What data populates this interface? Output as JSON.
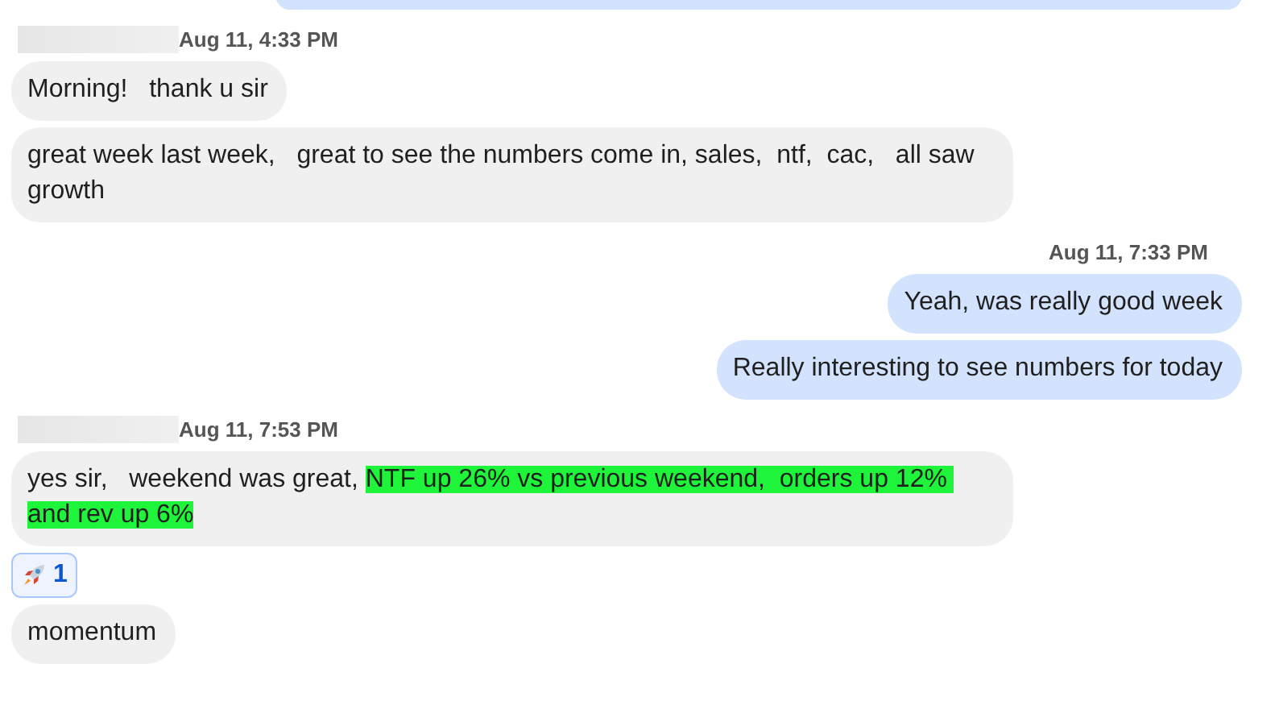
{
  "groups": [
    {
      "kind": "clipped"
    },
    {
      "kind": "incoming",
      "name_redacted": true,
      "time": "Aug 11, 4:33 PM",
      "messages": [
        {
          "segments": [
            {
              "text": "Morning!   thank u sir",
              "highlight": false
            }
          ]
        },
        {
          "segments": [
            {
              "text": "great week last week,   great to see the numbers come in, sales,  ntf,  cac,   all saw growth",
              "highlight": false
            }
          ]
        }
      ]
    },
    {
      "kind": "outgoing",
      "name_redacted": false,
      "time": "Aug 11, 7:33 PM",
      "messages": [
        {
          "segments": [
            {
              "text": "Yeah, was really good week",
              "highlight": false
            }
          ]
        },
        {
          "segments": [
            {
              "text": "Really interesting to see numbers for today",
              "highlight": false
            }
          ]
        }
      ]
    },
    {
      "kind": "incoming",
      "name_redacted": true,
      "time": "Aug 11, 7:53 PM",
      "messages": [
        {
          "segments": [
            {
              "text": "yes sir,   weekend was great, ",
              "highlight": false
            },
            {
              "text": "NTF up 26% vs previous weekend,  orders up 12% and rev up 6%",
              "highlight": true
            }
          ],
          "reaction": {
            "kind": "rocket",
            "count": "1"
          }
        },
        {
          "segments": [
            {
              "text": "momentum",
              "highlight": false
            }
          ]
        }
      ]
    }
  ]
}
